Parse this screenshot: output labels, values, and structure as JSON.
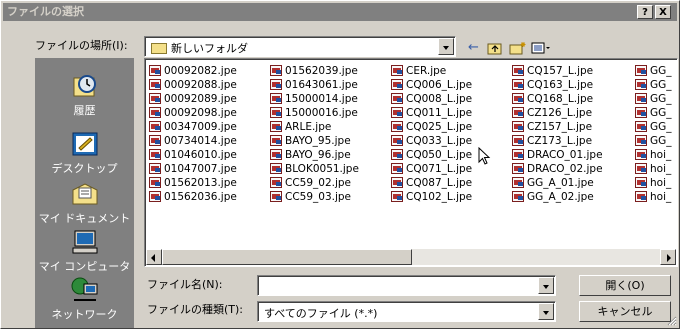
{
  "window": {
    "title": "ファイルの選択",
    "help_button": "?",
    "close_button": "X"
  },
  "look_in": {
    "label": "ファイルの場所(I):",
    "value": "新しいフォルダ"
  },
  "toolbar": {
    "back": "back-arrow-icon",
    "up": "up-folder-icon",
    "new_folder": "new-folder-icon",
    "view": "view-menu-icon"
  },
  "places": [
    {
      "label": "履歴",
      "icon": "history-icon"
    },
    {
      "label": "デスクトップ",
      "icon": "desktop-icon"
    },
    {
      "label": "マイ ドキュメント",
      "icon": "my-documents-icon"
    },
    {
      "label": "マイ コンピュータ",
      "icon": "my-computer-icon"
    },
    {
      "label": "ネットワーク",
      "icon": "network-icon"
    }
  ],
  "files": {
    "col1": [
      "00092082.jpe",
      "00092088.jpe",
      "00092089.jpe",
      "00092098.jpe",
      "00347009.jpe",
      "00734014.jpe",
      "01046010.jpe",
      "01047007.jpe",
      "01562013.jpe",
      "01562036.jpe"
    ],
    "col2": [
      "01562039.jpe",
      "01643061.jpe",
      "15000014.jpe",
      "15000016.jpe",
      "ARLE.jpe",
      "BAYO_95.jpe",
      "BAYO_96.jpe",
      "BLOK0051.jpe",
      "CC59_02.jpe",
      "CC59_03.jpe"
    ],
    "col3": [
      "CER.jpe",
      "CQ006_L.jpe",
      "CQ008_L.jpe",
      "CQ011_L.jpe",
      "CQ025_L.jpe",
      "CQ033_L.jpe",
      "CQ050_L.jpe",
      "CQ071_L.jpe",
      "CQ087_L.jpe",
      "CQ102_L.jpe"
    ],
    "col4": [
      "CQ157_L.jpe",
      "CQ163_L.jpe",
      "CQ168_L.jpe",
      "CZ126_L.jpe",
      "CZ157_L.jpe",
      "CZ173_L.jpe",
      "DRACO_01.jpe",
      "DRACO_02.jpe",
      "GG_A_01.jpe",
      "GG_A_02.jpe"
    ],
    "col5": [
      "GG_",
      "GG_",
      "GG_",
      "GG_",
      "GG_",
      "GG_",
      "hoi_",
      "hoi_",
      "hoi_",
      "hoi_"
    ]
  },
  "filename": {
    "label": "ファイル名(N):",
    "value": ""
  },
  "filetype": {
    "label": "ファイルの種類(T):",
    "value": "すべてのファイル (*.*)"
  },
  "buttons": {
    "open": "開く(O)",
    "cancel": "キャンセル"
  },
  "colors": {
    "face": "#d4d0c8",
    "title_inactive": "#808080",
    "places_bar": "#808080"
  }
}
